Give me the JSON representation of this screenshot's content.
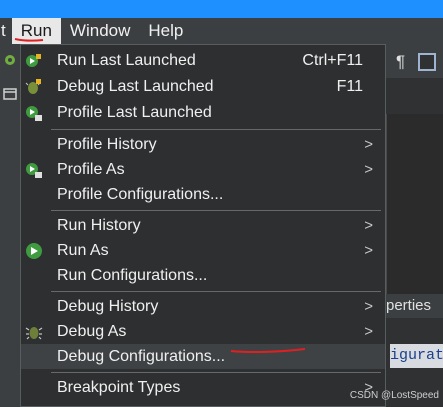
{
  "menubar": {
    "items": [
      {
        "label": "t"
      },
      {
        "label": "Run"
      },
      {
        "label": "Window"
      },
      {
        "label": "Help"
      }
    ]
  },
  "run_menu": {
    "items": [
      {
        "label": "Run Last Launched",
        "shortcut": "Ctrl+F11",
        "icon": "run-last-icon"
      },
      {
        "label": "Debug Last Launched",
        "shortcut": "F11",
        "icon": "debug-last-icon"
      },
      {
        "label": "Profile Last Launched",
        "icon": "profile-last-icon"
      },
      {
        "label": "Profile History",
        "submenu": true
      },
      {
        "label": "Profile As",
        "submenu": true,
        "icon": "profile-as-icon"
      },
      {
        "label": "Profile Configurations..."
      },
      {
        "label": "Run History",
        "submenu": true
      },
      {
        "label": "Run As",
        "submenu": true,
        "icon": "run-as-icon"
      },
      {
        "label": "Run Configurations..."
      },
      {
        "label": "Debug History",
        "submenu": true
      },
      {
        "label": "Debug As",
        "submenu": true,
        "icon": "bug-icon"
      },
      {
        "label": "Debug Configurations...",
        "selected": true
      },
      {
        "label": "Breakpoint Types",
        "submenu": true
      }
    ],
    "submenu_arrow": ">"
  },
  "background": {
    "properties_tab": "perties",
    "config_text": "igurat",
    "pilcrow": "¶"
  },
  "watermark": "CSDN @LostSpeed",
  "colors": {
    "accent_blue": "#1e90ff",
    "menu_bg": "#2d2f31",
    "selected_bg": "#3e4245",
    "annotation_red": "#e02020"
  }
}
